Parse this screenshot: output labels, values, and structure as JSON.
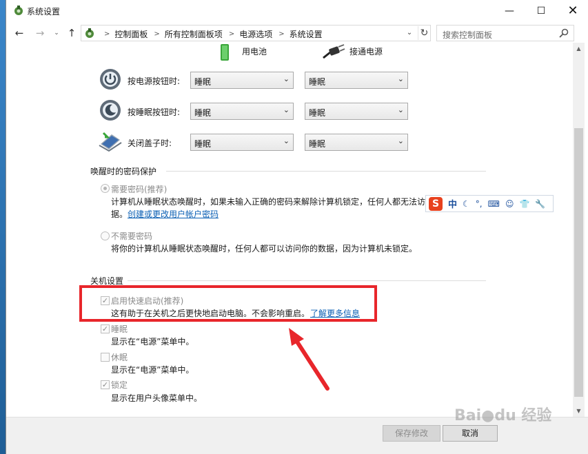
{
  "window": {
    "title": "系统设置",
    "minimize": "—",
    "maximize": "☐",
    "close": "✕"
  },
  "nav": {
    "back": "←",
    "forward": "→",
    "recent": "⌄",
    "up": "↑",
    "breadcrumbs": [
      "控制面板",
      "所有控制面板项",
      "电源选项",
      "系统设置"
    ],
    "dropdown": "⌄",
    "refresh": "↻",
    "search_placeholder": "搜索控制面板"
  },
  "power": {
    "col_battery": "用电池",
    "col_plugged": "接通电源",
    "rows": [
      {
        "label": "按电源按钮时:",
        "battery": "睡眠",
        "plugged": "睡眠"
      },
      {
        "label": "按睡眠按钮时:",
        "battery": "睡眠",
        "plugged": "睡眠"
      },
      {
        "label": "关闭盖子时:",
        "battery": "睡眠",
        "plugged": "睡眠"
      }
    ]
  },
  "wake_password": {
    "section_title": "唤醒时的密码保护",
    "require_label": "需要密码(推荐)",
    "require_desc1": "计算机从睡眠状态唤醒时，如果未输入正确的密码来解除计算机锁定，任何人都无法访",
    "require_desc2": "据。",
    "require_link": "创建或更改用户帐户密码",
    "norequire_label": "不需要密码",
    "norequire_desc": "将你的计算机从睡眠状态唤醒时，任何人都可以访问你的数据，因为计算机未锁定。"
  },
  "shutdown": {
    "section_title": "关机设置",
    "fast_startup_label": "启用快速启动(推荐)",
    "fast_startup_desc": "这有助于在关机之后更快地启动电脑。不会影响重启。",
    "fast_startup_link": "了解更多信息",
    "sleep_label": "睡眠",
    "sleep_desc": "显示在“电源”菜单中。",
    "hibernate_label": "休眠",
    "hibernate_desc": "显示在“电源”菜单中。",
    "lock_label": "锁定",
    "lock_desc": "显示在用户头像菜单中。"
  },
  "footer": {
    "save": "保存修改",
    "cancel": "取消"
  },
  "ime": {
    "logo": "S",
    "lang": "中"
  },
  "colors": {
    "annotation_red": "#e8262b",
    "link_blue": "#0a5fb4"
  }
}
